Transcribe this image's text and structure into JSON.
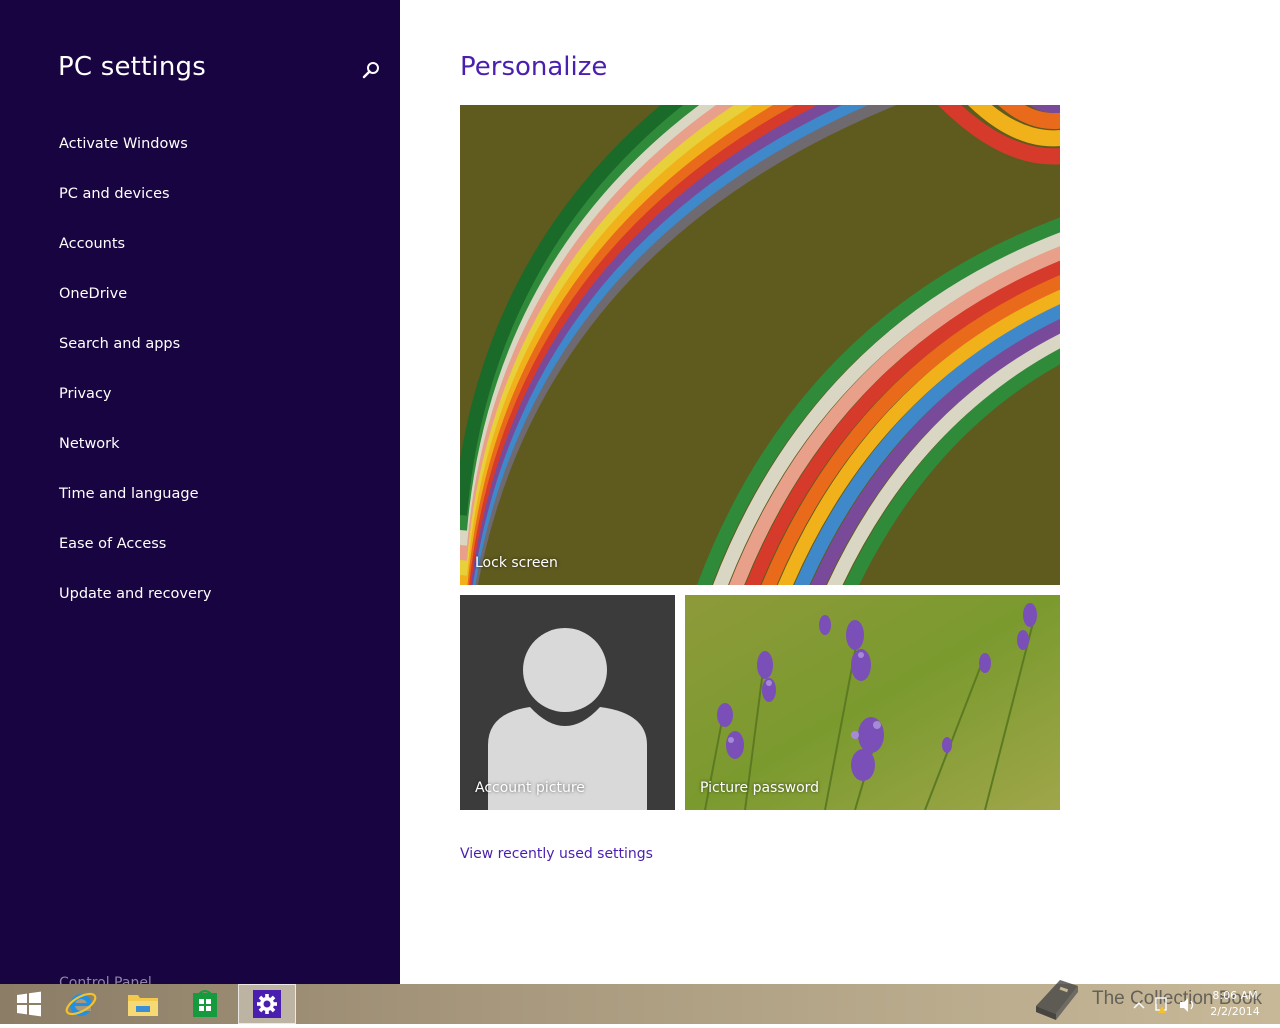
{
  "sidebar": {
    "title": "PC settings",
    "search_icon": "search-icon",
    "items": [
      {
        "label": "Activate Windows"
      },
      {
        "label": "PC and devices"
      },
      {
        "label": "Accounts"
      },
      {
        "label": "OneDrive"
      },
      {
        "label": "Search and apps"
      },
      {
        "label": "Privacy"
      },
      {
        "label": "Network"
      },
      {
        "label": "Time and language"
      },
      {
        "label": "Ease of Access"
      },
      {
        "label": "Update and recovery"
      }
    ],
    "control_panel": "Control Panel"
  },
  "main": {
    "title": "Personalize",
    "tiles": {
      "lock_screen": "Lock screen",
      "account_picture": "Account picture",
      "picture_password": "Picture password"
    },
    "recent_link": "View recently used settings"
  },
  "taskbar": {
    "apps": [
      "start-icon",
      "internet-explorer-icon",
      "file-explorer-icon",
      "store-icon",
      "settings-icon"
    ],
    "watermark": "The Collection Book",
    "clock_time": "8:06 AM",
    "clock_date": "2/2/2014"
  },
  "colors": {
    "sidebar_bg": "#180441",
    "accent": "#4a1fb0",
    "account_tile_bg": "#3b3b3b"
  }
}
